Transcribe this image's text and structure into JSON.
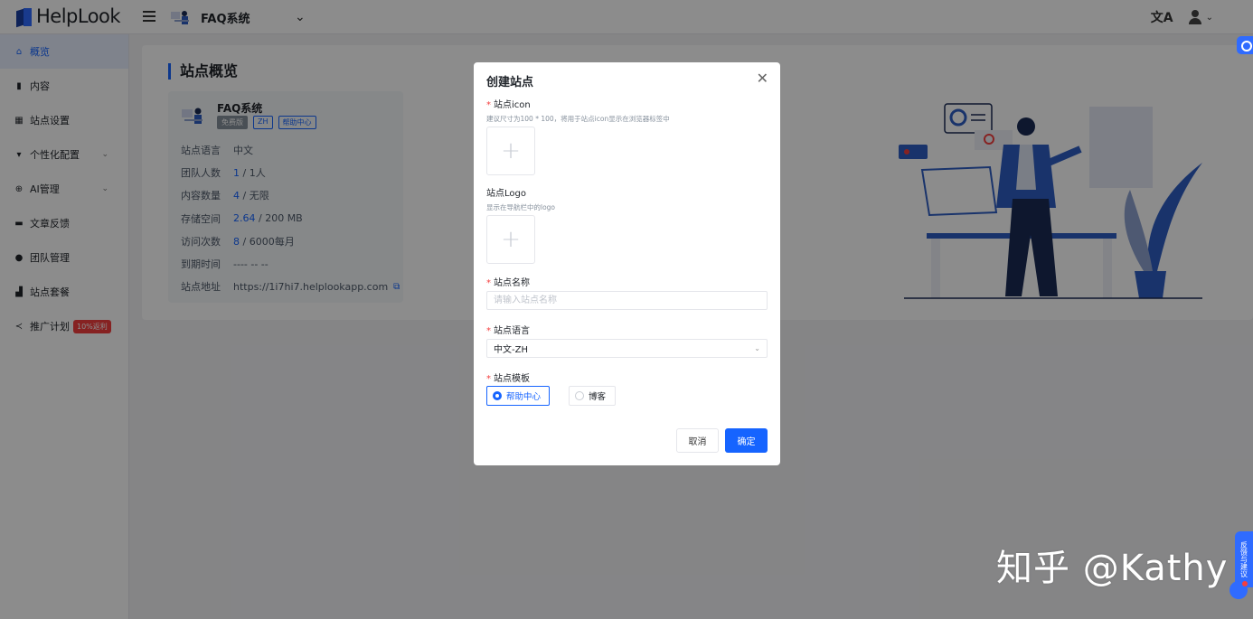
{
  "app": {
    "brand": "HelpLook",
    "site_name": "FAQ系统"
  },
  "sidebar": {
    "items": [
      {
        "label": "概览",
        "icon": "home-icon"
      },
      {
        "label": "内容",
        "icon": "content-icon"
      },
      {
        "label": "站点设置",
        "icon": "grid-icon"
      },
      {
        "label": "个性化配置",
        "icon": "brush-icon"
      },
      {
        "label": "AI管理",
        "icon": "ai-icon"
      },
      {
        "label": "文章反馈",
        "icon": "feedback-icon"
      },
      {
        "label": "团队管理",
        "icon": "team-icon"
      },
      {
        "label": "站点套餐",
        "icon": "bag-icon"
      },
      {
        "label": "推广计划",
        "icon": "share-icon",
        "badge": "10%返利"
      }
    ]
  },
  "overview": {
    "title": "站点概览",
    "site_name": "FAQ系统",
    "tags": [
      "免费版",
      "ZH",
      "帮助中心"
    ],
    "rows": [
      {
        "key": "站点语言",
        "value": "中文",
        "highlight": ""
      },
      {
        "key": "团队人数",
        "value": "1人",
        "highlight": "1"
      },
      {
        "key": "内容数量",
        "value": "无限",
        "highlight": "4"
      },
      {
        "key": "存储空间",
        "value": "200 MB",
        "highlight": "2.64"
      },
      {
        "key": "访问次数",
        "value": "6000每月",
        "highlight": "8"
      },
      {
        "key": "到期时间",
        "value": "---- -- --",
        "highlight": ""
      },
      {
        "key": "站点地址",
        "value": "https://1i7hi7.helplookapp.com",
        "highlight": ""
      }
    ]
  },
  "modal": {
    "title": "创建站点",
    "icon_label": "站点icon",
    "icon_hint": "建议尺寸为100 * 100，将用于站点icon显示在浏览器标签中",
    "logo_label": "站点Logo",
    "logo_hint": "显示在导航栏中的logo",
    "name_label": "站点名称",
    "name_placeholder": "请输入站点名称",
    "name_value": "",
    "lang_label": "站点语言",
    "lang_value": "中文-ZH",
    "template_label": "站点模板",
    "template_options": [
      "帮助中心",
      "博客"
    ],
    "template_selected": "帮助中心",
    "cancel": "取消",
    "confirm": "确定"
  },
  "widgets": {
    "feedback": "反馈与建议"
  },
  "watermark": "知乎 @Kathy",
  "colors": {
    "primary": "#1664ff",
    "danger": "#f53f3f"
  }
}
